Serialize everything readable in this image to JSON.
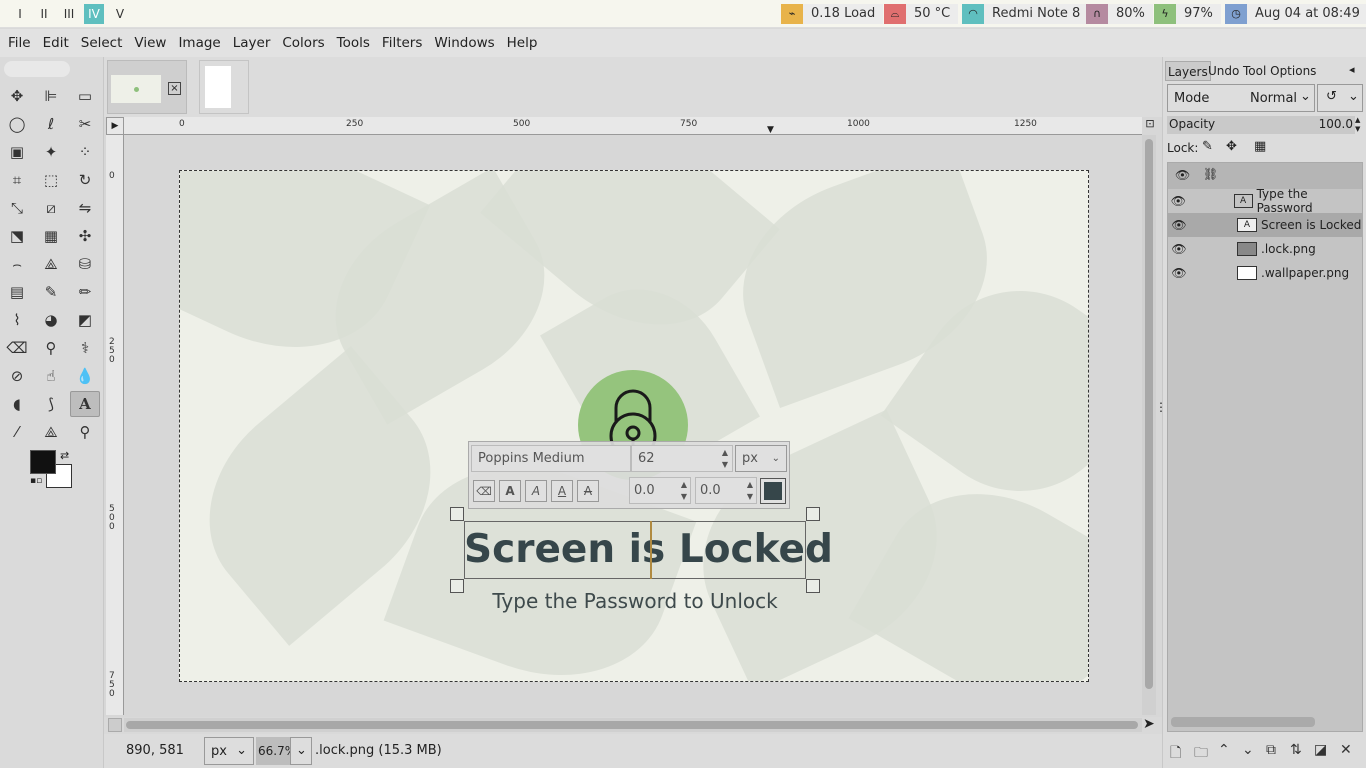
{
  "topbar": {
    "workspaces": [
      "I",
      "II",
      "III",
      "IV",
      "V"
    ],
    "active_workspace": "IV",
    "load": "0.18 Load",
    "temp": "50 °C",
    "wifi": "Redmi Note 8",
    "volume": "80%",
    "battery": "97%",
    "datetime": "Aug 04 at 08:49",
    "colors": {
      "load": "#e8b34a",
      "temp": "#e06f6f",
      "wifi": "#5fbfbf",
      "volume": "#b58aa0",
      "battery": "#8ec07c",
      "clock": "#7fa0d0"
    }
  },
  "menubar": {
    "items": [
      "File",
      "Edit",
      "Select",
      "View",
      "Image",
      "Layer",
      "Colors",
      "Tools",
      "Filters",
      "Windows",
      "Help"
    ]
  },
  "ruler": {
    "labels": [
      "0",
      "250",
      "500",
      "750",
      "1000",
      "1250"
    ],
    "vlabels": [
      "0",
      "250",
      "500",
      "750"
    ]
  },
  "canvas": {
    "title_text": "Screen is Locked",
    "subtitle_text": "Type the Password to Unlock"
  },
  "text_editor": {
    "font": "Poppins Medium",
    "size": "62",
    "unit": "px",
    "offset_x": "0.0",
    "offset_y": "0.0",
    "color": "#36464a"
  },
  "statusbar": {
    "coords": "890, 581",
    "unit": "px",
    "zoom": "66.7%",
    "file_info": ".lock.png (15.3 MB)"
  },
  "dock": {
    "tabs": [
      "Layers",
      "Undo",
      "Tool Options"
    ],
    "mode_label": "Mode",
    "mode_value": "Normal",
    "opacity_label": "Opacity",
    "opacity_value": "100.0",
    "lock_label": "Lock:",
    "layers": [
      {
        "name": "Type the Password",
        "selected": false
      },
      {
        "name": "Screen is Locked",
        "selected": true
      },
      {
        "name": ".lock.png",
        "selected": false
      },
      {
        "name": ".wallpaper.png",
        "selected": false
      }
    ]
  }
}
